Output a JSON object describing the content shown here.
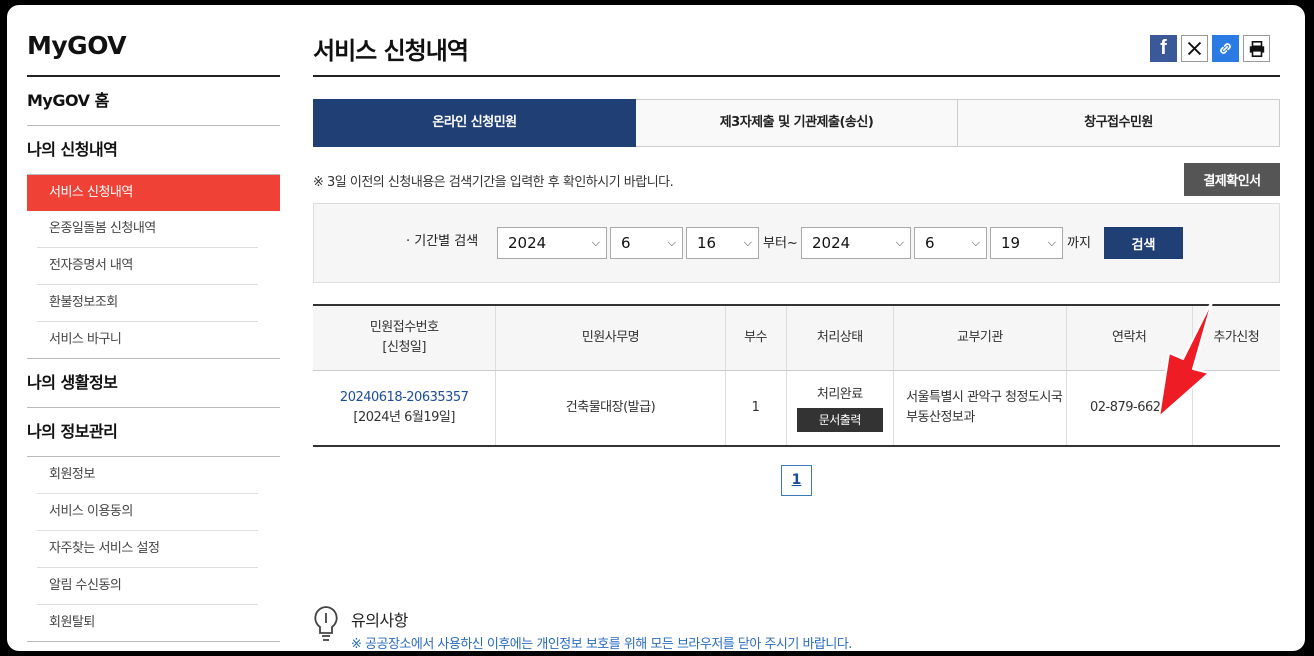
{
  "sidebar": {
    "brand": "MyGOV",
    "home": "MyGOV 홈",
    "section_apply": "나의 신청내역",
    "apply_items": [
      "서비스 신청내역",
      "온종일돌봄 신청내역",
      "전자증명서 내역",
      "환불정보조회",
      "서비스 바구니"
    ],
    "section_life": "나의 생활정보",
    "section_info": "나의 정보관리",
    "info_items": [
      "회원정보",
      "서비스 이용동의",
      "자주찾는 서비스 설정",
      "알림 수신동의",
      "회원탈퇴"
    ]
  },
  "header": {
    "title": "서비스 신청내역",
    "share_icons": [
      "facebook-icon",
      "x-icon",
      "link-icon",
      "print-icon"
    ]
  },
  "tabs": [
    "온라인 신청민원",
    "제3자제출 및 기관제출(송신)",
    "창구접수민원"
  ],
  "notice": "※ 3일 이전의 신청내용은 검색기간을 입력한 후 확인하시기 바랍니다.",
  "receipt_button": "결제확인서",
  "search": {
    "label": "· 기간별 검색",
    "from_year": "2024",
    "from_month": "6",
    "from_day": "16",
    "from_text": "부터~",
    "to_year": "2024",
    "to_month": "6",
    "to_day": "19",
    "to_text": "까지",
    "button": "검색"
  },
  "table": {
    "headers": [
      "민원접수번호",
      "[신청일]",
      "민원사무명",
      "부수",
      "처리상태",
      "교부기관",
      "연락처",
      "추가신청"
    ],
    "row": {
      "receipt_no": "20240618-20635357",
      "date": "[2024년 6월19일]",
      "service": "건축물대장(발급)",
      "copies": "1",
      "status": "처리완료",
      "print_button": "문서출력",
      "agency_line1": "서울특별시 관악구 청정도시국",
      "agency_line2": "부동산정보과",
      "contact": "02-879-6625",
      "extra": ""
    }
  },
  "pagination": {
    "current": "1"
  },
  "caution": {
    "title": "유의사항",
    "text": "※ 공공장소에서 사용하신 이후에는 개인정보 보호를 위해 모든 브라우저를 닫아 주시기 바랍니다."
  },
  "colors": {
    "accent_red": "#ef4136",
    "navy": "#1f3f75",
    "arrow": "#ee1c24"
  }
}
